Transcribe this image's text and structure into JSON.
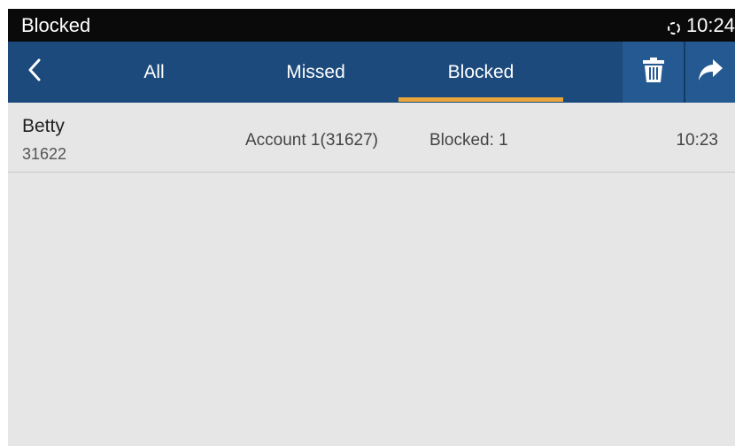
{
  "status_bar": {
    "title": "Blocked",
    "time": "10:24",
    "sync_icon": "sync-icon"
  },
  "tabs": {
    "back_icon": "chevron-left-icon",
    "items": [
      {
        "label": "All",
        "active": false
      },
      {
        "label": "Missed",
        "active": false
      },
      {
        "label": "Blocked",
        "active": true
      }
    ],
    "delete_icon": "trash-icon",
    "forward_icon": "forward-icon"
  },
  "calls": [
    {
      "name": "Betty",
      "number": "31622",
      "account": "Account 1(31627)",
      "status": "Blocked: 1",
      "time": "10:23"
    }
  ],
  "colors": {
    "status_bar_bg": "#0a0a0a",
    "tab_bar_bg": "#1c4a7c",
    "tab_indicator": "#e9a53a",
    "list_bg": "#e6e6e6"
  }
}
